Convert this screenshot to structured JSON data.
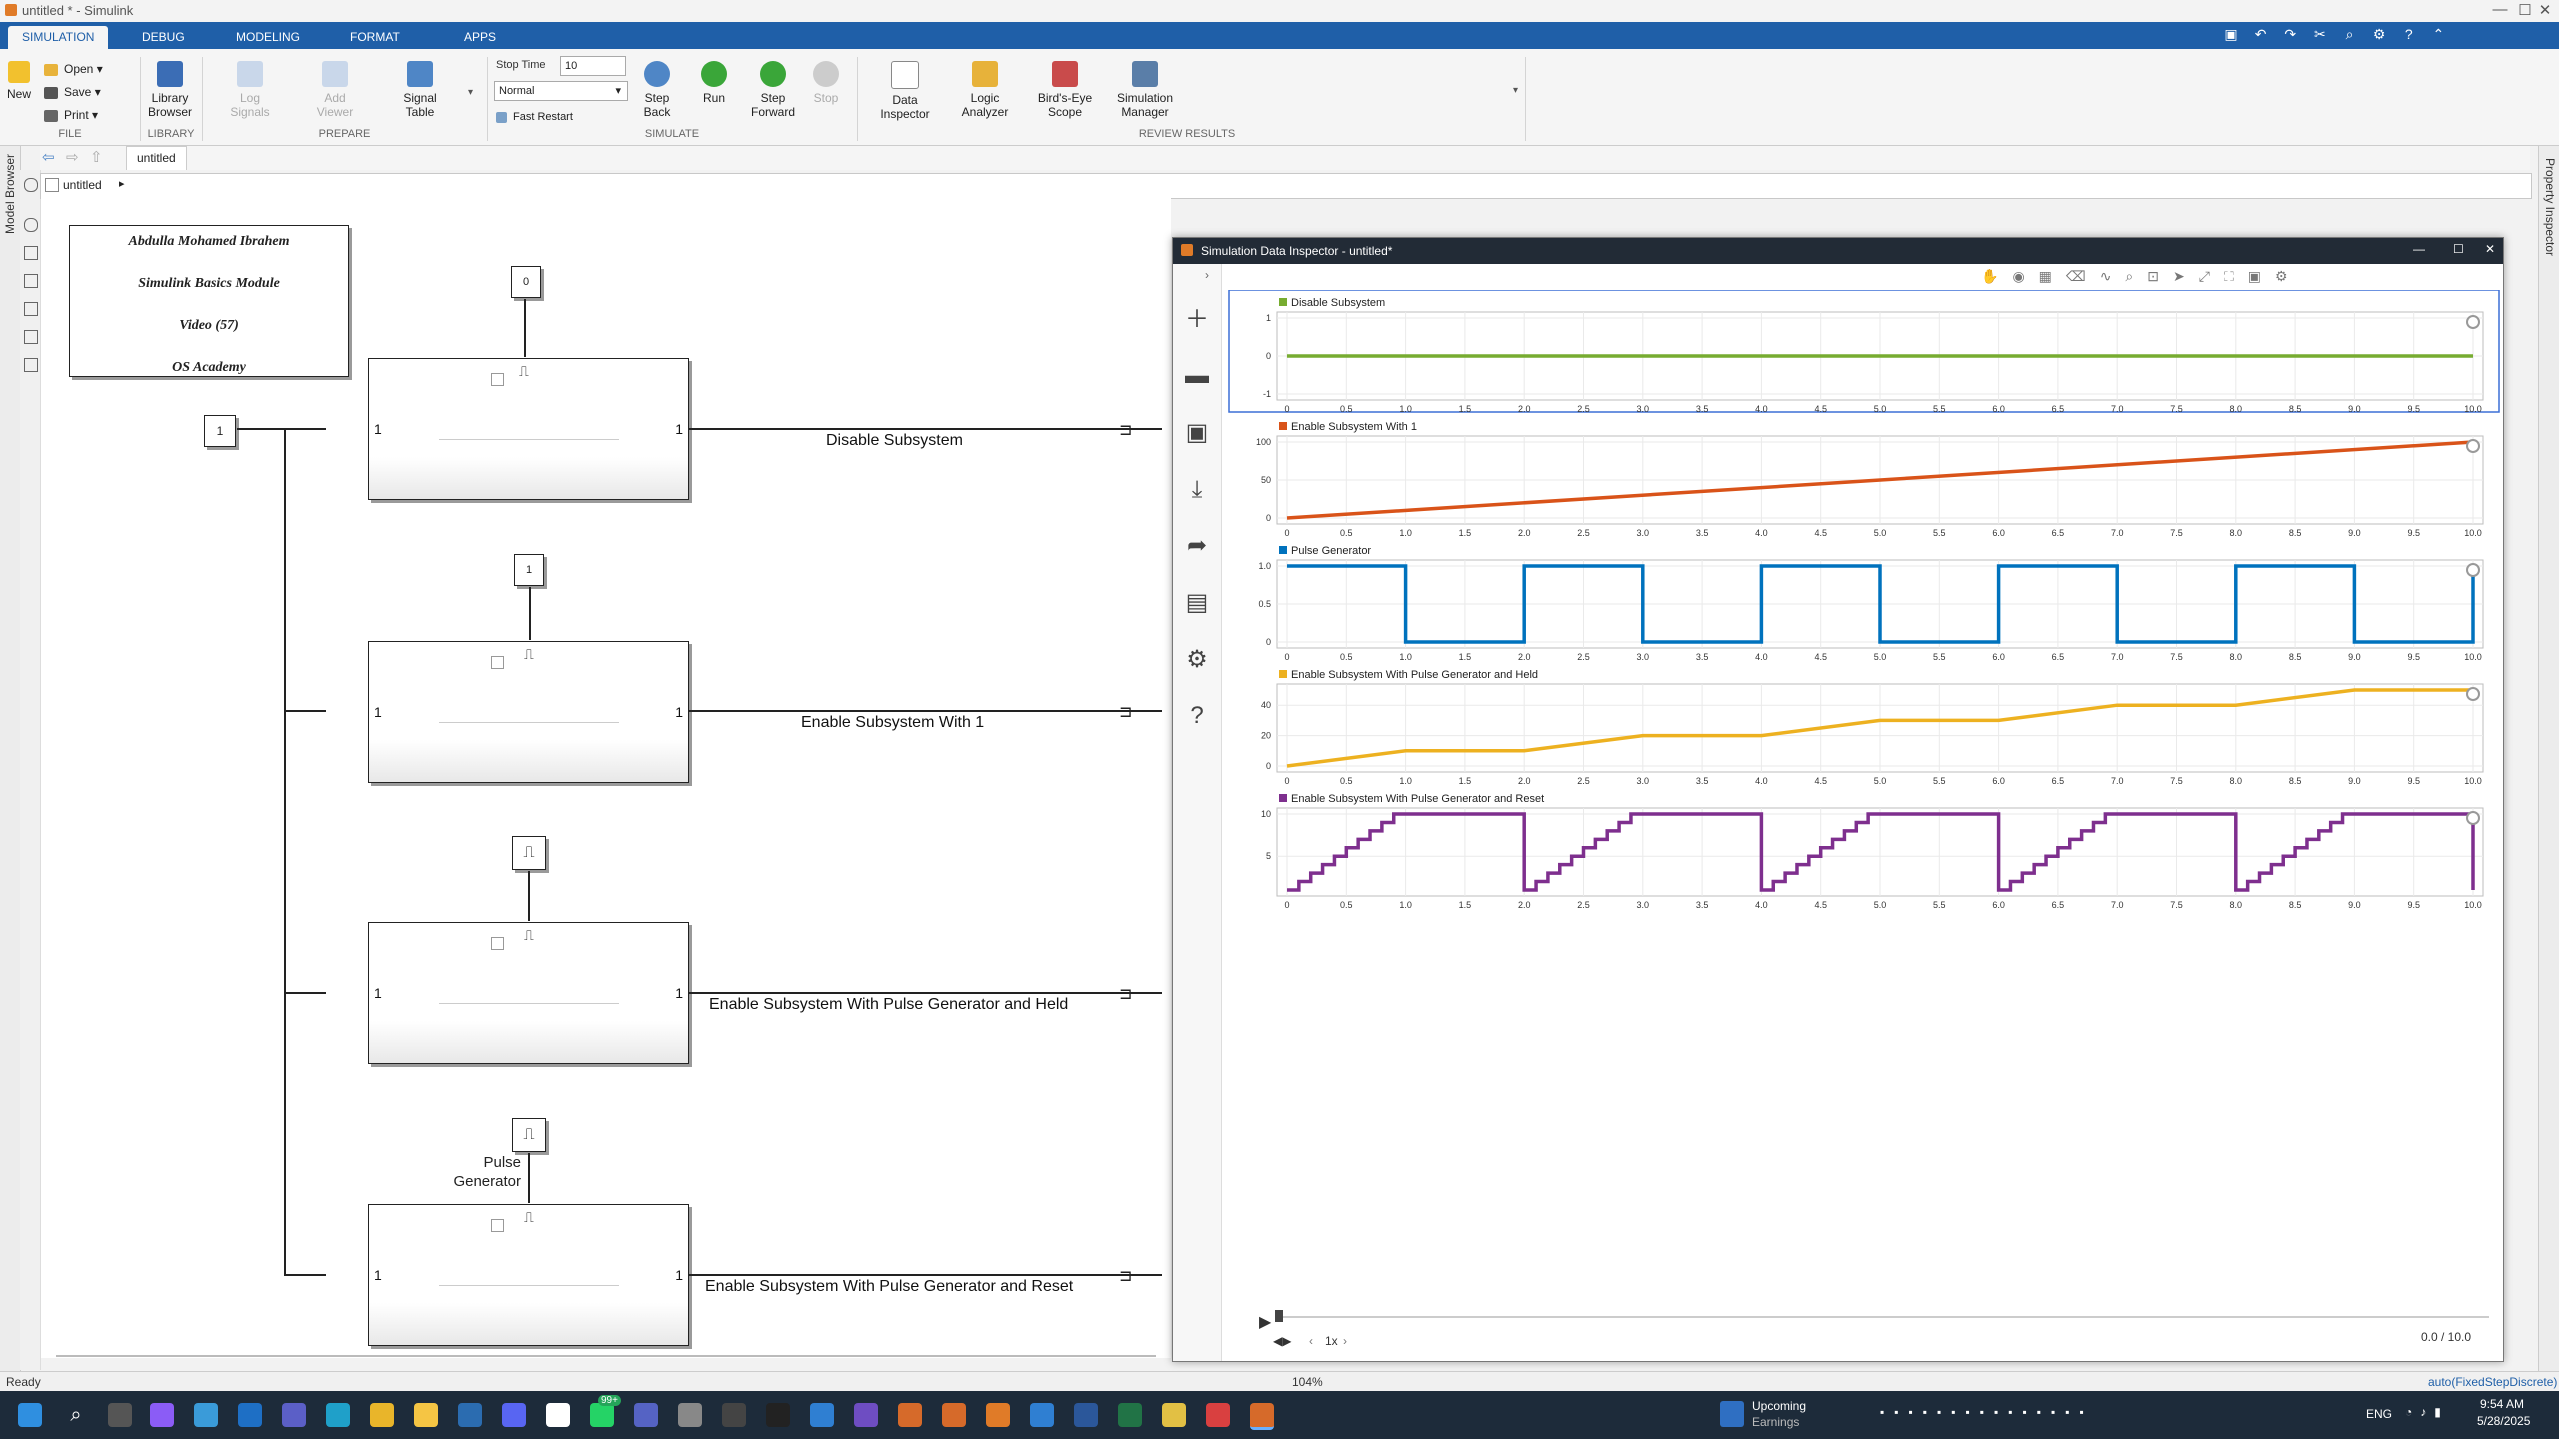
{
  "window": {
    "title": "untitled * - Simulink",
    "min": "—",
    "max": "☐",
    "close": "✕"
  },
  "tabs": [
    "SIMULATION",
    "DEBUG",
    "MODELING",
    "FORMAT",
    "APPS"
  ],
  "ribbon": {
    "file": {
      "new": "New",
      "open": "Open",
      "save": "Save",
      "print": "Print",
      "group": "FILE"
    },
    "library": {
      "browser": "Library Browser",
      "group": "LIBRARY"
    },
    "prepare": {
      "log_signals": "Log Signals",
      "add_viewer": "Add Viewer",
      "signal_table": "Signal Table",
      "group": "PREPARE"
    },
    "simulate": {
      "stop_time_label": "Stop Time",
      "stop_time": "10",
      "mode": "Normal",
      "fast_restart": "Fast Restart",
      "step_back": "Step Back",
      "run": "Run",
      "step_forward": "Step Forward",
      "stop": "Stop",
      "group": "SIMULATE"
    },
    "review": {
      "data_inspector": "Data Inspector",
      "logic_analyzer": "Logic Analyzer",
      "birds_eye": "Bird's-Eye Scope",
      "sim_manager": "Simulation Manager",
      "group": "REVIEW RESULTS"
    }
  },
  "nav": {
    "tab": "untitled",
    "crumb": "untitled"
  },
  "side": {
    "left": "Model Browser",
    "right": "Property Inspector"
  },
  "model": {
    "annotation": [
      "Abdulla Mohamed Ibrahem",
      "Simulink Basics Module",
      "Video (57)",
      "OS Academy"
    ],
    "const_main": "1",
    "const_top": "0",
    "const_2": "1",
    "pulse_label": "Pulse\nGenerator",
    "port_in": "1",
    "port_out": "1",
    "signals": [
      "Disable Subsystem",
      "Enable Subsystem With 1",
      "Enable Subsystem With Pulse Generator and Held",
      "Enable Subsystem With Pulse Generator and Reset"
    ]
  },
  "sdi": {
    "title": "Simulation Data Inspector - untitled*",
    "time_readout": "0.0 / 10.0",
    "speed": "1x",
    "x_ticks": [
      "0",
      "0.5",
      "1.0",
      "1.5",
      "2.0",
      "2.5",
      "3.0",
      "3.5",
      "4.0",
      "4.5",
      "5.0",
      "5.5",
      "6.0",
      "6.5",
      "7.0",
      "7.5",
      "8.0",
      "8.5",
      "9.0",
      "9.5",
      "10.0"
    ]
  },
  "chart_data": [
    {
      "type": "line",
      "title": "Disable Subsystem",
      "color": "#77ac30",
      "ylim": [
        -1,
        1
      ],
      "yticks": [
        "1",
        "0",
        "-1"
      ],
      "yvals": [
        1,
        0,
        -1
      ],
      "x": [
        0,
        10
      ],
      "y": [
        0,
        0
      ],
      "step": false
    },
    {
      "type": "line",
      "title": "Enable Subsystem With 1",
      "color": "#d95319",
      "ylim": [
        0,
        100
      ],
      "yticks": [
        "100",
        "50",
        "0"
      ],
      "yvals": [
        100,
        50,
        0
      ],
      "x": [
        0,
        10
      ],
      "y": [
        0,
        100
      ],
      "step": false
    },
    {
      "type": "line",
      "title": "Pulse Generator",
      "color": "#0072bd",
      "ylim": [
        0,
        1
      ],
      "yticks": [
        "1.0",
        "0.5",
        "0"
      ],
      "yvals": [
        1,
        0.5,
        0
      ],
      "x": [
        0,
        1,
        1,
        2,
        2,
        3,
        3,
        4,
        4,
        5,
        5,
        6,
        6,
        7,
        7,
        8,
        8,
        9,
        9,
        10,
        10
      ],
      "y": [
        1,
        1,
        0,
        0,
        1,
        1,
        0,
        0,
        1,
        1,
        0,
        0,
        1,
        1,
        0,
        0,
        1,
        1,
        0,
        0,
        1
      ],
      "step": false
    },
    {
      "type": "line",
      "title": "Enable Subsystem With Pulse Generator and Held",
      "color": "#edb120",
      "ylim": [
        0,
        50
      ],
      "yticks": [
        "40",
        "20",
        "0"
      ],
      "yvals": [
        40,
        20,
        0
      ],
      "x": [
        0,
        1,
        2,
        3,
        4,
        5,
        6,
        7,
        8,
        9,
        10
      ],
      "y": [
        0,
        10,
        10,
        20,
        20,
        30,
        30,
        40,
        40,
        50,
        50
      ],
      "step": false
    },
    {
      "type": "line",
      "title": "Enable Subsystem With Pulse Generator and Reset",
      "color": "#7e2f8e",
      "ylim": [
        1,
        10
      ],
      "yticks": [
        "10",
        "5"
      ],
      "yvals": [
        10,
        5
      ],
      "x": [
        0,
        0.1,
        0.2,
        0.3,
        0.4,
        0.5,
        0.6,
        0.7,
        0.8,
        0.9,
        1.0,
        2.0,
        2.0,
        2.1,
        2.2,
        2.3,
        2.4,
        2.5,
        2.6,
        2.7,
        2.8,
        2.9,
        3.0,
        4.0,
        4.0,
        4.1,
        4.2,
        4.3,
        4.4,
        4.5,
        4.6,
        4.7,
        4.8,
        4.9,
        5.0,
        6.0,
        6.0,
        6.1,
        6.2,
        6.3,
        6.4,
        6.5,
        6.6,
        6.7,
        6.8,
        6.9,
        7.0,
        8.0,
        8.0,
        8.1,
        8.2,
        8.3,
        8.4,
        8.5,
        8.6,
        8.7,
        8.8,
        8.9,
        9.0,
        10.0,
        10.0
      ],
      "y": [
        1,
        2,
        3,
        4,
        5,
        6,
        7,
        8,
        9,
        10,
        10,
        10,
        1,
        2,
        3,
        4,
        5,
        6,
        7,
        8,
        9,
        10,
        10,
        10,
        1,
        2,
        3,
        4,
        5,
        6,
        7,
        8,
        9,
        10,
        10,
        10,
        1,
        2,
        3,
        4,
        5,
        6,
        7,
        8,
        9,
        10,
        10,
        10,
        1,
        2,
        3,
        4,
        5,
        6,
        7,
        8,
        9,
        10,
        10,
        10,
        1
      ],
      "step": true
    }
  ],
  "status": {
    "left": "Ready",
    "zoom": "104%",
    "solver": "auto(FixedStepDiscrete)"
  },
  "taskbar": {
    "weather_title": "Upcoming",
    "weather_sub": "Earnings",
    "lang": "ENG",
    "time": "9:54 AM",
    "date": "5/28/2025",
    "badge": "99+"
  }
}
